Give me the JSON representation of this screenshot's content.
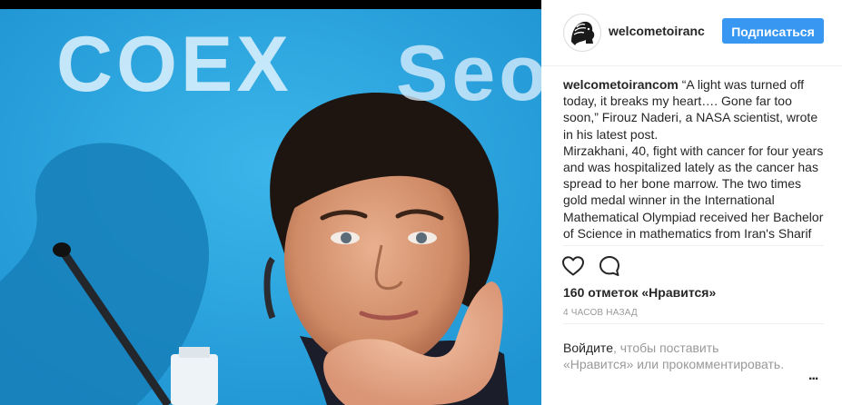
{
  "photo": {
    "backdrop_text_1": "COEX",
    "backdrop_text_2": "Seo"
  },
  "header": {
    "username": "welcometoiranc",
    "follow_label": "Подписаться"
  },
  "caption": {
    "author": "welcometoirancom",
    "paragraph_1": " “A light was turned off today, it breaks my heart…. Gone far too soon,” Firouz Naderi, a NASA scientist, wrote in his latest post.",
    "paragraph_2": "Mirzakhani, 40, fight with cancer for four years and was hospitalized lately as the cancer has spread to her bone marrow. The two times gold medal winner in the International Mathematical Olympiad received her Bachelor of Science in mathematics from Iran's Sharif University"
  },
  "actions": {
    "like_icon": "heart-outline-icon",
    "comment_icon": "comment-bubble-icon"
  },
  "likes": "160 отметок «Нравится»",
  "timestamp": "4 часов назад",
  "login": {
    "link": "Войдите",
    "text": ", чтобы поставить «Нравится» или прокомментировать."
  },
  "more_options": "...",
  "colors": {
    "follow_button": "#3897f0",
    "photo_backdrop": "#2aa6dd"
  }
}
